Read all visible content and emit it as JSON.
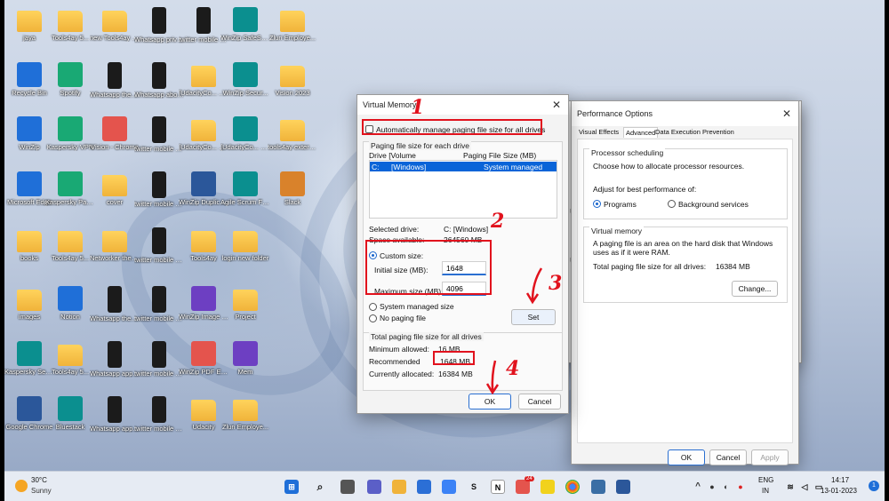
{
  "desktop": {
    "icons": [
      {
        "label": "jaya",
        "kind": "folder"
      },
      {
        "label": "Tools4ay 5...",
        "kind": "folder"
      },
      {
        "label": "new Tools4ay session 3",
        "kind": "folder"
      },
      {
        "label": "Whatsapp privacy s...",
        "kind": "phone"
      },
      {
        "label": "twitter mobile 7.jpg",
        "kind": "phone"
      },
      {
        "label": "WinZip SafeShare",
        "kind": "app"
      },
      {
        "label": "Zluri Employe...",
        "kind": "folder"
      },
      {
        "label": "Recycle Bin",
        "kind": "app"
      },
      {
        "label": "Spotify",
        "kind": "app"
      },
      {
        "label": "Whatsapp theme sce...",
        "kind": "phone"
      },
      {
        "label": "Whatsapp about sett...",
        "kind": "phone"
      },
      {
        "label": "[UdacityCo... Become a ...",
        "kind": "folder"
      },
      {
        "label": "WinZip Secur...",
        "kind": "app"
      },
      {
        "label": "Vision 2023",
        "kind": "folder"
      },
      {
        "label": "WinZip",
        "kind": "app"
      },
      {
        "label": "Kaspersky VPN",
        "kind": "app"
      },
      {
        "label": "Vision - Chrome",
        "kind": "app"
      },
      {
        "label": "twitter mobile 1.jpg",
        "kind": "phone"
      },
      {
        "label": "[UdacityCo... Become a ...",
        "kind": "folder"
      },
      {
        "label": "[UdacityCo... Become a ...",
        "kind": "app"
      },
      {
        "label": "tools4ay external...",
        "kind": "folder"
      },
      {
        "label": "Microsoft Edge",
        "kind": "app"
      },
      {
        "label": "Kaspersky Passwor...",
        "kind": "app"
      },
      {
        "label": "cover",
        "kind": "folder"
      },
      {
        "label": "twitter mobile 3.jpg",
        "kind": "phone"
      },
      {
        "label": "WinZip Duplicate Fi...",
        "kind": "app"
      },
      {
        "label": "Agile Scrum Full Course ...",
        "kind": "app"
      },
      {
        "label": "Slack",
        "kind": "app"
      },
      {
        "label": "books",
        "kind": "folder"
      },
      {
        "label": "Tools4ay 5...",
        "kind": "folder"
      },
      {
        "label": "Networker theme (Kor 4",
        "kind": "folder"
      },
      {
        "label": "twitter mobile 2.jpg",
        "kind": "phone"
      },
      {
        "label": "Tools4ay",
        "kind": "folder"
      },
      {
        "label": "login new folder",
        "kind": "folder"
      },
      {
        "label": "images",
        "kind": "folder"
      },
      {
        "label": "Notion",
        "kind": "app"
      },
      {
        "label": "Whatsapp theme scre...",
        "kind": "phone"
      },
      {
        "label": "twitter mobile 4.jpg",
        "kind": "phone"
      },
      {
        "label": "WinZip Image M...",
        "kind": "app"
      },
      {
        "label": "Project",
        "kind": "folder"
      },
      {
        "label": "Kaspersky Security ...",
        "kind": "app"
      },
      {
        "label": "Tools4ay 5...",
        "kind": "folder"
      },
      {
        "label": "Whatsapp app androi...",
        "kind": "phone"
      },
      {
        "label": "twitter mobile 5.jpg",
        "kind": "phone"
      },
      {
        "label": "WinZip PDF Express",
        "kind": "app"
      },
      {
        "label": "Mem",
        "kind": "app"
      },
      {
        "label": "Google Chrome",
        "kind": "app"
      },
      {
        "label": "Bluestack",
        "kind": "app"
      },
      {
        "label": "Whatsapp app privat...",
        "kind": "phone"
      },
      {
        "label": "twitter mobile 6.jpg",
        "kind": "phone"
      },
      {
        "label": "Udacity",
        "kind": "folder"
      },
      {
        "label": "Zluri Employe...",
        "kind": "folder"
      }
    ]
  },
  "virtual_memory": {
    "title": "Virtual Memory",
    "auto_manage_label": "Automatically manage paging file size for all drives",
    "group_each_drive": "Paging file size for each drive",
    "col_drive": "Drive  [Volume",
    "col_size": "Paging File Size (MB)",
    "drive_row": {
      "drive": "C:",
      "volume": "[Windows]",
      "size": "System managed"
    },
    "selected_drive_label": "Selected drive:",
    "selected_drive_value": "C:  [Windows]",
    "space_available_label": "Space available:",
    "space_available_value": "264560 MB",
    "custom_size_label": "Custom size:",
    "initial_size_label": "Initial size (MB):",
    "initial_size_value": "1648",
    "maximum_size_label": "Maximum size (MB):",
    "maximum_size_value": "4096",
    "system_managed_label": "System managed size",
    "no_paging_label": "No paging file",
    "set_button": "Set",
    "group_total": "Total paging file size for all drives",
    "minimum_allowed_label": "Minimum allowed:",
    "minimum_allowed_value": "16 MB",
    "recommended_label": "Recommended",
    "recommended_value": "1648 MB",
    "currently_allocated_label": "Currently allocated:",
    "currently_allocated_value": "16384 MB",
    "ok_button": "OK",
    "cancel_button": "Cancel"
  },
  "performance_options": {
    "title": "Performance Options",
    "tabs": [
      "Visual Effects",
      "Advanced",
      "Data Execution Prevention"
    ],
    "active_tab": "Advanced",
    "processor_group": "Processor scheduling",
    "processor_desc": "Choose how to allocate processor resources.",
    "adjust_label": "Adjust for best performance of:",
    "opt_programs": "Programs",
    "opt_background": "Background services",
    "vm_group": "Virtual memory",
    "vm_desc": "A paging file is an area on the hard disk that Windows uses as if it were RAM.",
    "total_label": "Total paging file size for all drives:",
    "total_value": "16384 MB",
    "change_button": "Change...",
    "ok_button": "OK",
    "cancel_button": "Cancel",
    "apply_button": "Apply"
  },
  "behind_window": {
    "partial_title": "ste",
    "partial_char_1": "U",
    "partial_char_2": "U"
  },
  "annotations": {
    "n1": "1",
    "n2": "2",
    "n3": "3",
    "n4": "4"
  },
  "taskbar": {
    "weather_temp": "30°C",
    "weather_desc": "Sunny",
    "lang_top": "ENG",
    "lang_bottom": "IN",
    "time": "14:17",
    "date": "13-01-2023",
    "notification_count": "1",
    "chrome_badge": "24"
  },
  "colors": {
    "annotation_red": "#e1121d",
    "accent_blue": "#2a6fd1",
    "selection_blue": "#0a64d8"
  }
}
